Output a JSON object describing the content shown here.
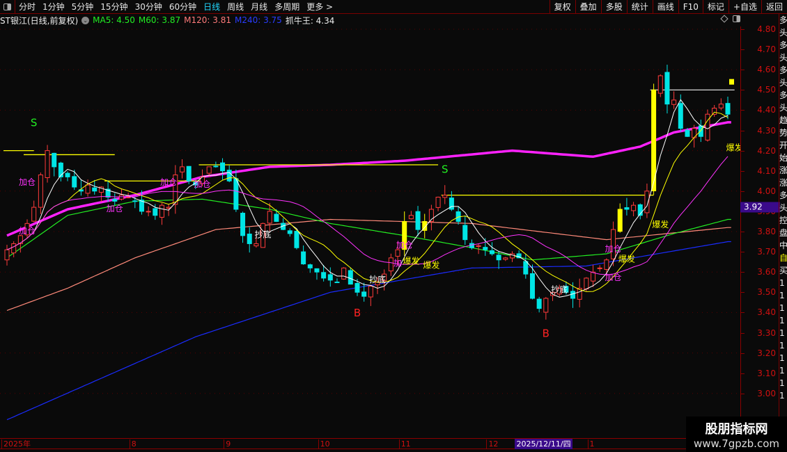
{
  "toolbar": {
    "periods": [
      "分时",
      "1分钟",
      "5分钟",
      "15分钟",
      "30分钟",
      "60分钟",
      "日线",
      "周线",
      "月线",
      "多周期",
      "更多 >"
    ],
    "active_period": "日线",
    "right_buttons": [
      "复权",
      "叠加",
      "多股",
      "统计",
      "画线",
      "F10",
      "标记",
      "+自选",
      "返回"
    ]
  },
  "info": {
    "title": "ST银江(日线,前复权)",
    "ma5": "MA5: 4.50",
    "m60": "M60: 3.87",
    "m120": "M120: 3.81",
    "m240": "M240: 3.75",
    "zhuaniu": "抓牛王: 4.34"
  },
  "colors": {
    "up": "#ff3b3b",
    "down": "#00e5e5",
    "ma5": "#ffffff",
    "ma10": "#ffff00",
    "ma20": "#ff33ff",
    "m60": "#22ee22",
    "m120": "#ff8a7a",
    "m240": "#1a2cff",
    "thick": "#ff22ff",
    "hline": "#ffff00",
    "accent": "#3a0a8a"
  },
  "axis": {
    "price_labels": [
      "4.80",
      "4.70",
      "4.60",
      "4.50",
      "4.40",
      "4.30",
      "4.20",
      "4.10",
      "4.00",
      "3.90",
      "3.80",
      "3.70",
      "3.60",
      "3.50",
      "3.40",
      "3.30",
      "3.20",
      "3.10",
      "3.00"
    ],
    "current_price": "3.92",
    "time_labels": [
      {
        "label": "2025年",
        "bar": 0
      },
      {
        "label": "8",
        "bar": 19
      },
      {
        "label": "9",
        "bar": 33
      },
      {
        "label": "10",
        "bar": 47
      },
      {
        "label": "11",
        "bar": 59
      },
      {
        "label": "12",
        "bar": 72
      },
      {
        "label": "1",
        "bar": 87
      }
    ],
    "cursor_date": {
      "label": "2025/12/11/四",
      "bar": 78
    }
  },
  "sidebar_chars": [
    "多",
    "头",
    "多",
    "头",
    "多",
    "头",
    "多",
    "头",
    "趋",
    "势",
    "开",
    "始",
    "涨",
    "涨",
    "多",
    "头",
    "控",
    "盘",
    "中",
    "自",
    "买",
    "1",
    "1",
    "1",
    "1",
    "1",
    "1",
    "1",
    "1",
    "1",
    "1"
  ],
  "watermark": {
    "line1": "股朋指标网",
    "line2": "www.7gpzb.com"
  },
  "chart_data": {
    "type": "candlestick",
    "title": "ST银江(日线,前复权)",
    "ylim": [
      2.85,
      4.85
    ],
    "closes": [
      3.71,
      3.74,
      3.78,
      3.84,
      3.92,
      4.08,
      4.2,
      4.12,
      4.07,
      4.07,
      4.02,
      4.0,
      4.03,
      4.0,
      4.02,
      3.97,
      3.95,
      3.98,
      3.97,
      3.95,
      3.9,
      3.9,
      3.88,
      3.93,
      3.92,
      4.08,
      4.12,
      4.05,
      4.03,
      4.07,
      4.12,
      4.12,
      4.1,
      4.05,
      3.91,
      3.78,
      3.74,
      3.74,
      3.84,
      3.9,
      3.85,
      3.81,
      3.79,
      3.72,
      3.64,
      3.62,
      3.6,
      3.57,
      3.56,
      3.55,
      3.62,
      3.54,
      3.5,
      3.48,
      3.53,
      3.55,
      3.59,
      3.67,
      3.71,
      3.85,
      3.88,
      3.81,
      3.85,
      3.91,
      3.97,
      3.98,
      3.91,
      3.85,
      3.76,
      3.72,
      3.73,
      3.71,
      3.69,
      3.66,
      3.67,
      3.69,
      3.67,
      3.59,
      3.47,
      3.42,
      3.47,
      3.5,
      3.52,
      3.5,
      3.47,
      3.52,
      3.57,
      3.6,
      3.62,
      3.66,
      3.81,
      3.91,
      3.91,
      3.93,
      3.88,
      4.0,
      4.5,
      4.57,
      4.43,
      4.45,
      4.31,
      4.27,
      4.31,
      4.27,
      4.38,
      4.41,
      4.43,
      4.38
    ],
    "open_first": 3.66,
    "highlight_bars": [
      59,
      62,
      91,
      96
    ],
    "computed_mas": [
      {
        "name": "MA5",
        "period": 5,
        "color_key": "ma5"
      },
      {
        "name": "MA10",
        "period": 10,
        "color_key": "ma10"
      },
      {
        "name": "MA20",
        "period": 20,
        "color_key": "ma20"
      }
    ],
    "keypoint_lines": [
      {
        "name": "M240",
        "color_key": "m240",
        "width": 1.2,
        "points": [
          [
            0,
            2.87
          ],
          [
            28,
            3.28
          ],
          [
            48,
            3.5
          ],
          [
            69,
            3.62
          ],
          [
            86,
            3.63
          ],
          [
            107,
            3.75
          ]
        ]
      },
      {
        "name": "M120",
        "color_key": "m120",
        "width": 1.2,
        "points": [
          [
            0,
            3.41
          ],
          [
            9,
            3.52
          ],
          [
            19,
            3.67
          ],
          [
            31,
            3.81
          ],
          [
            48,
            3.86
          ],
          [
            69,
            3.84
          ],
          [
            89,
            3.76
          ],
          [
            107,
            3.82
          ]
        ]
      },
      {
        "name": "M60",
        "color_key": "m60",
        "width": 1.2,
        "points": [
          [
            0,
            3.67
          ],
          [
            9,
            3.88
          ],
          [
            19,
            3.95
          ],
          [
            29,
            3.96
          ],
          [
            39,
            3.91
          ],
          [
            48,
            3.84
          ],
          [
            59,
            3.78
          ],
          [
            69,
            3.72
          ],
          [
            78,
            3.66
          ],
          [
            89,
            3.69
          ],
          [
            99,
            3.79
          ],
          [
            107,
            3.86
          ]
        ]
      },
      {
        "name": "抓牛王",
        "color_key": "thick",
        "width": 3.5,
        "points": [
          [
            0,
            3.78
          ],
          [
            9,
            3.91
          ],
          [
            19,
            3.98
          ],
          [
            29,
            4.07
          ],
          [
            39,
            4.12
          ],
          [
            48,
            4.13
          ],
          [
            59,
            4.15
          ],
          [
            75,
            4.2
          ],
          [
            87,
            4.17
          ],
          [
            94,
            4.22
          ],
          [
            99,
            4.29
          ],
          [
            107,
            4.34
          ]
        ]
      }
    ],
    "hlines": [
      [
        0,
        4,
        4.2
      ],
      [
        3,
        16,
        4.18
      ],
      [
        15,
        29,
        4.05
      ],
      [
        29,
        64,
        4.13
      ],
      [
        65,
        96,
        3.98
      ]
    ],
    "white_hline": [
      96,
      108,
      4.5
    ],
    "signals": [
      {
        "text": "S",
        "bar": 4,
        "price": 4.32,
        "color": "#22ee22"
      },
      {
        "text": "S",
        "bar": 65,
        "price": 4.09,
        "color": "#22ee22"
      },
      {
        "text": "B",
        "bar": 52,
        "price": 3.38,
        "color": "#ff2222"
      },
      {
        "text": "B",
        "bar": 80,
        "price": 3.28,
        "color": "#ff2222"
      }
    ],
    "annotations": [
      {
        "text": "加仓",
        "bar": 3,
        "price": 4.03,
        "color": "#ff33ff"
      },
      {
        "text": "加仓",
        "bar": 3,
        "price": 3.79,
        "color": "#ff33ff"
      },
      {
        "text": "加仓",
        "bar": 16,
        "price": 3.9,
        "color": "#ff33ff"
      },
      {
        "text": "加仓",
        "bar": 24,
        "price": 4.03,
        "color": "#ff33ff"
      },
      {
        "text": "加仓",
        "bar": 29,
        "price": 4.02,
        "color": "#ff33ff"
      },
      {
        "text": "抄底",
        "bar": 38,
        "price": 3.77,
        "color": "#ffffff"
      },
      {
        "text": "加仓",
        "bar": 59,
        "price": 3.72,
        "color": "#ff33ff"
      },
      {
        "text": "加",
        "bar": 58,
        "price": 3.63,
        "color": "#ff33ff"
      },
      {
        "text": "爆发",
        "bar": 60,
        "price": 3.64,
        "color": "#ffff00"
      },
      {
        "text": "爆发",
        "bar": 63,
        "price": 3.62,
        "color": "#ffff00"
      },
      {
        "text": "抄底",
        "bar": 55,
        "price": 3.55,
        "color": "#ffffff"
      },
      {
        "text": "抄底",
        "bar": 82,
        "price": 3.5,
        "color": "#ffffff"
      },
      {
        "text": "加仓",
        "bar": 90,
        "price": 3.7,
        "color": "#ff33ff"
      },
      {
        "text": "加仓",
        "bar": 90,
        "price": 3.56,
        "color": "#ff33ff"
      },
      {
        "text": "爆发",
        "bar": 92,
        "price": 3.65,
        "color": "#ffff00"
      },
      {
        "text": "爆发",
        "bar": 97,
        "price": 3.82,
        "color": "#ffff00"
      },
      {
        "text": "爆发",
        "bar": 108,
        "price": 4.2,
        "color": "#ffff00"
      }
    ],
    "last_marker": {
      "bar": 107,
      "price": 4.54
    }
  }
}
